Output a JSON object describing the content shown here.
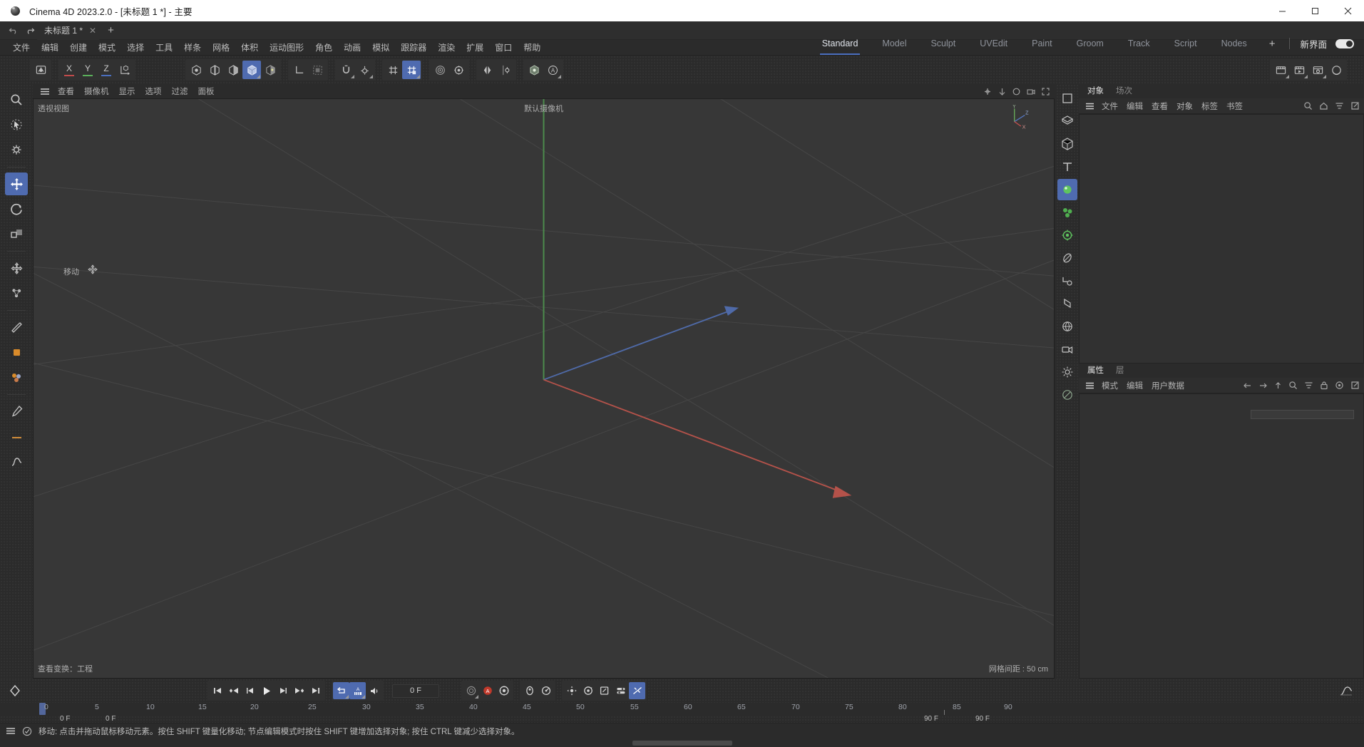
{
  "window": {
    "title": "Cinema 4D 2023.2.0 - [未标题 1 *] - 主要",
    "minimize": "—",
    "maximize": "□",
    "close": "✕"
  },
  "docbar": {
    "undo_icon": "undo-icon",
    "redo_icon": "redo-icon",
    "tab_label": "未标题 1 *",
    "tab_close": "✕",
    "new_tab": "+"
  },
  "menubar": {
    "items": [
      "文件",
      "编辑",
      "创建",
      "模式",
      "选择",
      "工具",
      "样条",
      "网格",
      "体积",
      "运动图形",
      "角色",
      "动画",
      "模拟",
      "跟踪器",
      "渲染",
      "扩展",
      "窗口",
      "帮助"
    ]
  },
  "layout_tabs": {
    "items": [
      "Standard",
      "Model",
      "Sculpt",
      "UVEdit",
      "Paint",
      "Groom",
      "Track",
      "Script",
      "Nodes"
    ],
    "active": "Standard",
    "add": "+",
    "new_ui_label": "新界面",
    "toggle_on": true,
    "accent": "#4b6fbf"
  },
  "toolbar": {
    "axes": [
      {
        "label": "X",
        "color": "#c14b4b"
      },
      {
        "label": "Y",
        "color": "#5bb05b"
      },
      {
        "label": "Z",
        "color": "#4b6fbf"
      }
    ],
    "groups": [
      {
        "name": "undo-group",
        "buttons": [
          {
            "icon": "live-selection-icon",
            "selected": false
          }
        ]
      },
      {
        "name": "axis-group",
        "buttons": []
      },
      {
        "name": "modes-group",
        "buttons": [
          {
            "icon": "point-mode-icon",
            "selected": false
          },
          {
            "icon": "edge-mode-icon",
            "selected": false
          },
          {
            "icon": "polygon-mode-icon",
            "selected": false
          },
          {
            "icon": "model-mode-icon",
            "selected": true
          },
          {
            "icon": "texture-mode-icon",
            "selected": false
          }
        ]
      },
      {
        "name": "axis-lock-group",
        "buttons": [
          {
            "icon": "object-axis-icon",
            "selected": false
          },
          {
            "icon": "workplane-icon",
            "selected": false
          }
        ]
      },
      {
        "name": "snap-group",
        "buttons": [
          {
            "icon": "magnet-icon",
            "selected": false
          },
          {
            "icon": "snap-settings-icon",
            "selected": false
          },
          {
            "icon": "grid-snap-icon",
            "selected": false
          },
          {
            "icon": "snap-enabled-icon",
            "selected": true
          }
        ]
      },
      {
        "name": "deform-group",
        "buttons": [
          {
            "icon": "deformer-icon",
            "selected": false
          },
          {
            "icon": "gear-icon",
            "selected": false
          }
        ]
      },
      {
        "name": "symmetry-group",
        "buttons": [
          {
            "icon": "symmetry-icon",
            "selected": false
          },
          {
            "icon": "symmetry-settings-icon",
            "selected": false
          }
        ]
      },
      {
        "name": "view-group",
        "buttons": [
          {
            "icon": "visibility-icon",
            "selected": false
          },
          {
            "icon": "annotation-icon",
            "selected": false
          }
        ]
      },
      {
        "name": "render-group",
        "buttons": [
          {
            "icon": "render-view-icon",
            "selected": false
          },
          {
            "icon": "render-picture-viewer-icon",
            "selected": false
          },
          {
            "icon": "render-settings-icon",
            "selected": false
          },
          {
            "icon": "material-sphere-icon",
            "selected": false
          }
        ]
      }
    ]
  },
  "left_tools": {
    "items": [
      {
        "icon": "magnifier-icon",
        "selected": false
      },
      {
        "icon": "live-selection-icon",
        "selected": false
      },
      {
        "icon": "selection-settings-icon",
        "selected": false
      },
      {
        "icon": "move-tool-icon",
        "selected": true
      },
      {
        "icon": "rotate-tool-icon",
        "selected": false
      },
      {
        "icon": "scale-tool-icon",
        "selected": false
      },
      {
        "icon": "axis-move-icon",
        "selected": false
      },
      {
        "icon": "workplane-move-icon",
        "selected": false
      },
      {
        "icon": "knife-icon",
        "selected": false
      },
      {
        "icon": "material-chip-icon",
        "selected": false
      },
      {
        "icon": "paint-icon",
        "selected": false
      },
      {
        "icon": "brush-icon",
        "selected": false
      },
      {
        "icon": "line-icon",
        "selected": false
      },
      {
        "icon": "spline-pen-icon",
        "selected": false
      }
    ]
  },
  "viewport": {
    "menus": [
      "查看",
      "摄像机",
      "显示",
      "选项",
      "过滤",
      "面板"
    ],
    "hamburger_icon": "hamburger-icon",
    "right_icons": [
      "pan-icon",
      "zoom-icon",
      "dolly-icon",
      "camera-icon",
      "maximize-icon"
    ],
    "label_top_left": "透视视图",
    "label_camera": "默认摄像机",
    "tool_hint": "移动",
    "label_bottom_left": "查看变换：工程",
    "label_bottom_right": "网格间距 : 50 cm",
    "axis_labels": {
      "x": "X",
      "y": "Y",
      "z": "Z"
    },
    "axis_colors": {
      "x": "#c9514f",
      "y": "#6ab45c",
      "z": "#5578c4"
    },
    "background": "#373737"
  },
  "object_manager": {
    "tabs": [
      "对象",
      "场次"
    ],
    "active_tab": "对象",
    "menus": [
      "文件",
      "编辑",
      "查看",
      "对象",
      "标签",
      "书签"
    ],
    "right_icons": [
      "search-icon",
      "home-icon",
      "filter-icon",
      "expand-icon"
    ]
  },
  "attribute_manager": {
    "tabs": [
      "属性",
      "层"
    ],
    "active_tab": "属性",
    "menus": [
      "模式",
      "编辑",
      "用户数据"
    ],
    "right_icons": [
      "back-arrow-icon",
      "forward-arrow-icon",
      "up-arrow-icon",
      "search-icon",
      "filter-icon",
      "lock-icon",
      "target-icon",
      "expand-icon"
    ]
  },
  "right_icon_column": {
    "items": [
      {
        "icon": "cube-primitive-icon",
        "selected": false
      },
      {
        "icon": "plane-primitive-icon",
        "selected": false
      },
      {
        "icon": "array-icon",
        "selected": false
      },
      {
        "icon": "text-spline-icon",
        "selected": false
      },
      {
        "icon": "green-sphere-icon",
        "selected": true
      },
      {
        "icon": "cloner-icon",
        "selected": false
      },
      {
        "icon": "effector-icon",
        "selected": false
      },
      {
        "icon": "bend-deformer-icon",
        "selected": false
      },
      {
        "icon": "field-icon",
        "selected": false
      },
      {
        "icon": "null-object-icon",
        "selected": false
      },
      {
        "icon": "environment-icon",
        "selected": false
      },
      {
        "icon": "camera-icon",
        "selected": false
      },
      {
        "icon": "light-icon",
        "selected": false
      },
      {
        "icon": "tag-icon",
        "selected": false
      }
    ]
  },
  "timeline": {
    "keyframe_icon": "keyframe-diamond-icon",
    "transport": [
      {
        "icon": "go-to-start-icon"
      },
      {
        "icon": "prev-key-icon"
      },
      {
        "icon": "step-back-icon"
      },
      {
        "icon": "play-icon"
      },
      {
        "icon": "step-forward-icon"
      },
      {
        "icon": "next-key-icon"
      },
      {
        "icon": "go-to-end-icon"
      }
    ],
    "loop_group": [
      {
        "icon": "loop-icon",
        "selected": true
      },
      {
        "icon": "autokey-icon",
        "selected": true
      },
      {
        "icon": "sound-icon",
        "selected": false
      }
    ],
    "current_frame": "0 F",
    "record_group": [
      {
        "icon": "record-position-icon",
        "selected": false
      },
      {
        "icon": "autokey-record-icon",
        "selected": false,
        "accent": "#c0392b"
      },
      {
        "icon": "record-active-objects-icon",
        "selected": false
      }
    ],
    "key_group": [
      {
        "icon": "keyframe-selection-icon",
        "selected": false
      },
      {
        "icon": "animation-mode-icon",
        "selected": false
      }
    ],
    "param_group": [
      {
        "icon": "position-key-icon",
        "selected": false
      },
      {
        "icon": "rotation-key-icon",
        "selected": false
      },
      {
        "icon": "scale-key-icon",
        "selected": false
      },
      {
        "icon": "parameter-key-icon",
        "selected": false
      },
      {
        "icon": "point-level-anim-icon",
        "selected": true
      }
    ],
    "curve_icon": "fcurve-icon",
    "ruler_ticks": [
      "0",
      "5",
      "10",
      "15",
      "20",
      "25",
      "30",
      "35",
      "40",
      "45",
      "50",
      "55",
      "60",
      "65",
      "70",
      "75",
      "80",
      "85",
      "90"
    ],
    "playhead_frame": 0,
    "range_start": "0 F",
    "range_current": "0 F",
    "range_end_left": "90 F",
    "range_end_right": "90 F"
  },
  "statusbar": {
    "hamburger_icon": "hamburger-icon",
    "check_icon": "check-circle-icon",
    "message": "移动: 点击并拖动鼠标移动元素。按住 SHIFT 键量化移动; 节点编辑模式时按住 SHIFT 键增加选择对象; 按住 CTRL 键减少选择对象。"
  }
}
